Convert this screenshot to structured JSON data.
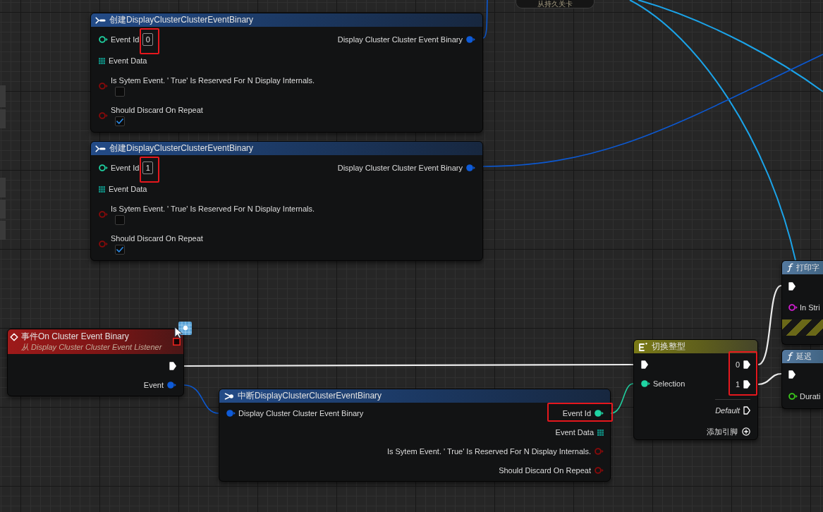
{
  "top_node": {
    "subtitle": "从持久关卡"
  },
  "make_nodes": [
    {
      "title": "创建DisplayClusterClusterEventBinary",
      "inputs": [
        {
          "kind": "int",
          "label": "Event Id",
          "value": "0",
          "connected": false,
          "highlighted": true
        },
        {
          "kind": "bytes",
          "label": "Event Data",
          "highlighted": false
        },
        {
          "kind": "bool",
          "label": "Is Sytem Event. ' True' Is Reserved For N Display Internals.",
          "connected": false,
          "checked": false,
          "highlighted": false
        },
        {
          "kind": "bool",
          "label": "Should Discard On Repeat",
          "connected": false,
          "checked": true,
          "highlighted": false
        }
      ],
      "outputs": [
        {
          "kind": "struct",
          "label": "Display Cluster Cluster Event Binary",
          "connected": true,
          "highlighted": false
        }
      ]
    },
    {
      "title": "创建DisplayClusterClusterEventBinary",
      "inputs": [
        {
          "kind": "int",
          "label": "Event Id",
          "value": "1",
          "connected": false,
          "highlighted": true
        },
        {
          "kind": "bytes",
          "label": "Event Data",
          "highlighted": false
        },
        {
          "kind": "bool",
          "label": "Is Sytem Event. ' True' Is Reserved For N Display Internals.",
          "connected": false,
          "checked": false,
          "highlighted": false
        },
        {
          "kind": "bool",
          "label": "Should Discard On Repeat",
          "connected": false,
          "checked": true,
          "highlighted": false
        }
      ],
      "outputs": [
        {
          "kind": "struct",
          "label": "Display Cluster Cluster Event Binary",
          "connected": true,
          "highlighted": false
        }
      ]
    }
  ],
  "event_node": {
    "title": "事件On Cluster Event Binary",
    "subtitle": "从 Display Cluster Cluster Event Listener",
    "outputs": [
      {
        "kind": "exec",
        "connected": true
      },
      {
        "kind": "struct",
        "label": "Event",
        "connected": true
      }
    ]
  },
  "break_node": {
    "title": "中断DisplayClusterClusterEventBinary",
    "inputs": [
      {
        "kind": "struct",
        "label": "Display Cluster Cluster Event Binary",
        "connected": true,
        "highlighted": false
      }
    ],
    "outputs": [
      {
        "kind": "int",
        "label": "Event Id",
        "connected": true,
        "highlighted": true
      },
      {
        "kind": "bytes",
        "label": "Event Data",
        "highlighted": false
      },
      {
        "kind": "bool",
        "label": "Is Sytem Event. ' True' Is Reserved For N Display Internals.",
        "connected": false,
        "highlighted": false
      },
      {
        "kind": "bool",
        "label": "Should Discard On Repeat",
        "connected": false,
        "highlighted": false
      }
    ]
  },
  "switch_node": {
    "title": "切换整型",
    "inputs": [
      {
        "kind": "exec",
        "connected": true
      },
      {
        "kind": "int",
        "label": "Selection",
        "connected": true
      }
    ],
    "case_group": {
      "highlighted": true,
      "pins": [
        {
          "kind": "exec",
          "label": "0",
          "connected": true
        },
        {
          "kind": "exec",
          "label": "1",
          "connected": true
        }
      ]
    },
    "default_pin": {
      "kind": "exec",
      "label": "Default",
      "connected": false
    },
    "add_pin_button": {
      "label": "添加引脚"
    }
  },
  "function_nodes": [
    {
      "title": "打印字",
      "development_only": true,
      "inputs": [
        {
          "kind": "exec",
          "connected": true
        },
        {
          "kind": "string",
          "label": "In Stri",
          "connected": false
        }
      ]
    },
    {
      "title": "延迟",
      "development_only": false,
      "inputs": [
        {
          "kind": "exec",
          "connected": true
        },
        {
          "kind": "float",
          "label": "Durati",
          "connected": false
        }
      ]
    }
  ]
}
